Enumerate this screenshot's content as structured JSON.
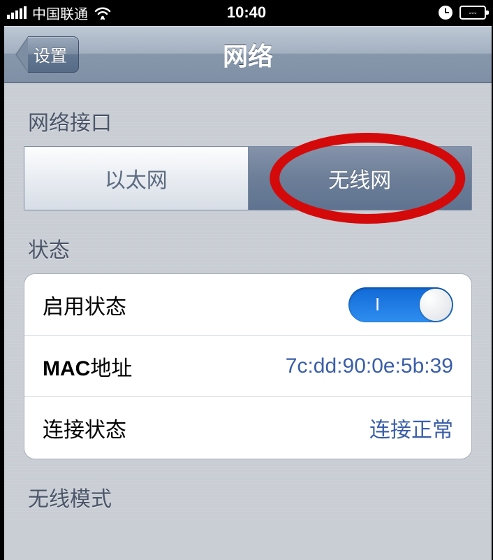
{
  "status_bar": {
    "carrier": "中国联通",
    "time": "10:40"
  },
  "nav": {
    "back_label": "设置",
    "title": "网络"
  },
  "sections": {
    "interface_header": "网络接口",
    "status_header": "状态",
    "wireless_mode_header": "无线模式"
  },
  "segmented": {
    "ethernet": "以太网",
    "wireless": "无线网"
  },
  "status_rows": {
    "enable_label": "启用状态",
    "toggle_on_text": "I",
    "mac_label_bold": "MAC",
    "mac_label_rest": "地址",
    "mac_value": "7c:dd:90:0e:5b:39",
    "conn_label": "连接状态",
    "conn_value": "连接正常"
  }
}
